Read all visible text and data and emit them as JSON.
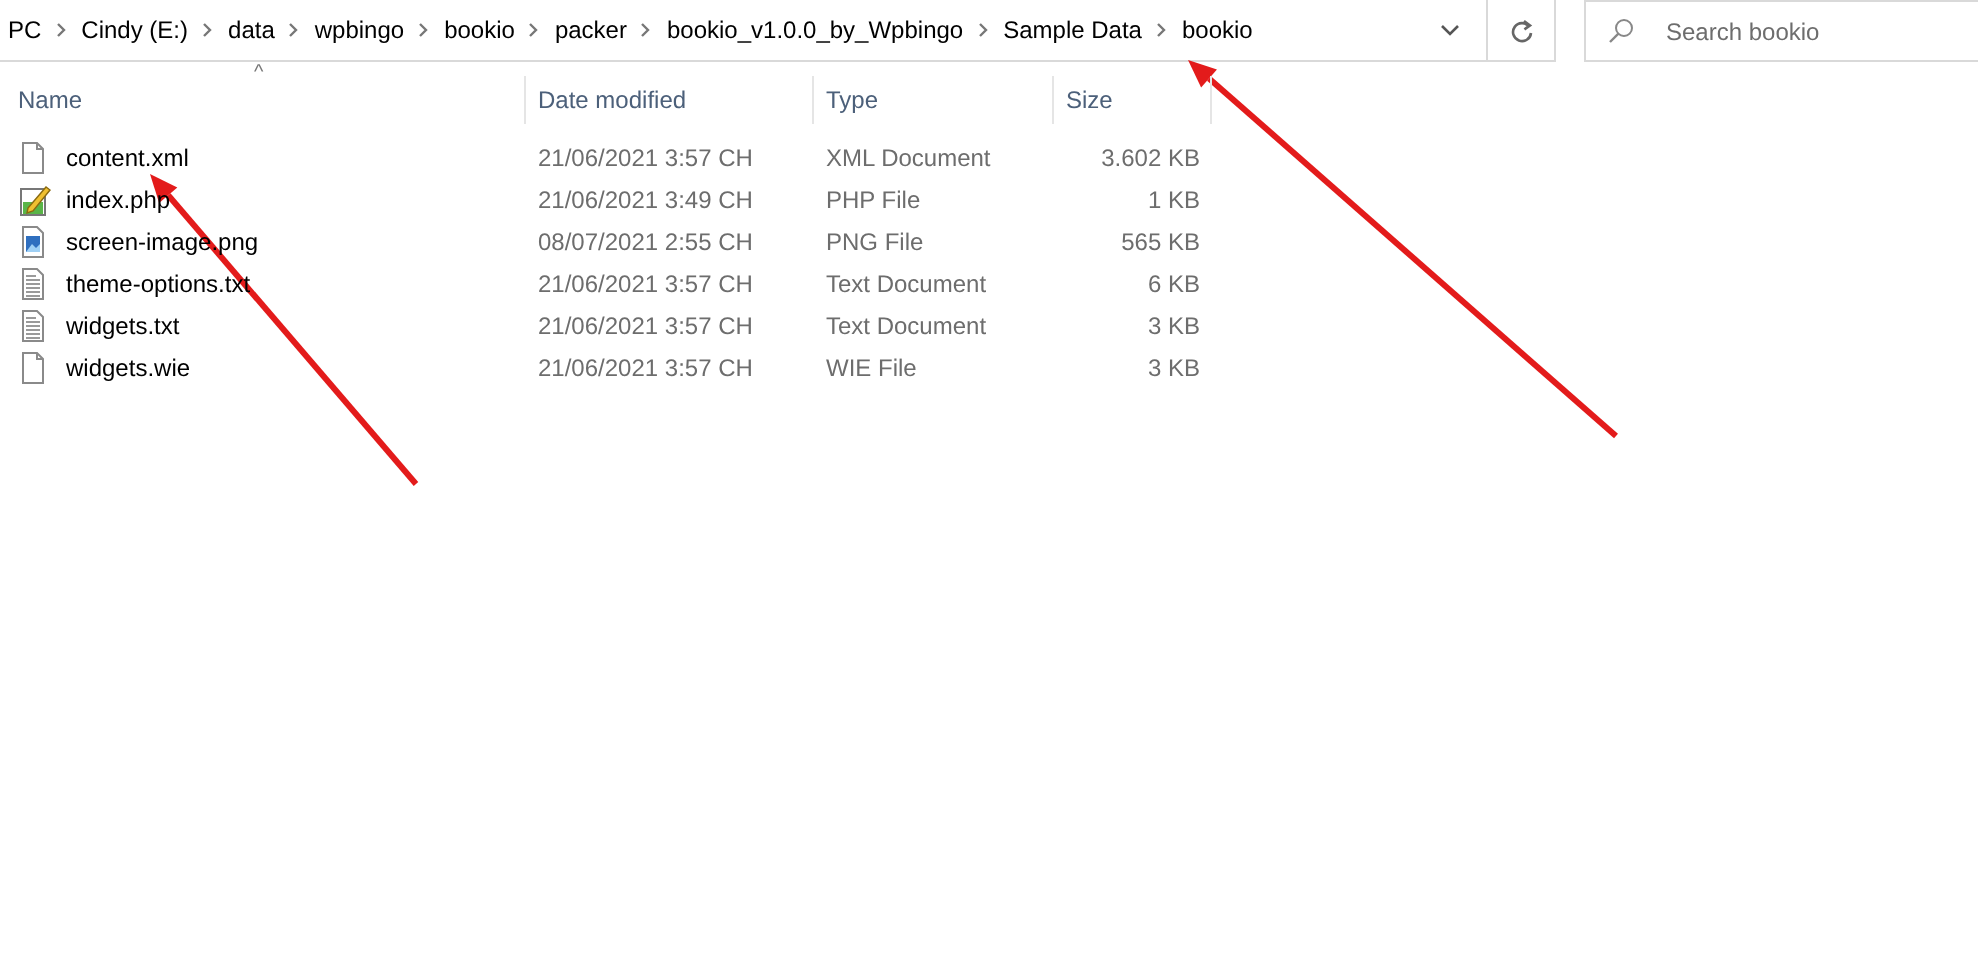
{
  "address_bar": {
    "path": [
      "PC",
      "Cindy (E:)",
      "data",
      "wpbingo",
      "bookio",
      "packer",
      "bookio_v1.0.0_by_Wpbingo",
      "Sample Data",
      "bookio"
    ]
  },
  "search": {
    "placeholder": "Search bookio"
  },
  "table": {
    "sort_indicator": "^",
    "columns": [
      "Name",
      "Date modified",
      "Type",
      "Size"
    ],
    "rows": [
      {
        "kind": "blank",
        "name": "content.xml",
        "date": "21/06/2021 3:57 CH",
        "type": "XML Document",
        "size": "3.602 KB"
      },
      {
        "kind": "script",
        "name": "index.php",
        "date": "21/06/2021 3:49 CH",
        "type": "PHP File",
        "size": "1 KB"
      },
      {
        "kind": "image",
        "name": "screen-image.png",
        "date": "08/07/2021 2:55 CH",
        "type": "PNG File",
        "size": "565 KB"
      },
      {
        "kind": "text",
        "name": "theme-options.txt",
        "date": "21/06/2021 3:57 CH",
        "type": "Text Document",
        "size": "6 KB"
      },
      {
        "kind": "text",
        "name": "widgets.txt",
        "date": "21/06/2021 3:57 CH",
        "type": "Text Document",
        "size": "3 KB"
      },
      {
        "kind": "blank",
        "name": "widgets.wie",
        "date": "21/06/2021 3:57 CH",
        "type": "WIE File",
        "size": "3 KB"
      }
    ]
  },
  "callout_arrows": [
    {
      "kind": "arrow"
    },
    {
      "kind": "arrow"
    }
  ]
}
